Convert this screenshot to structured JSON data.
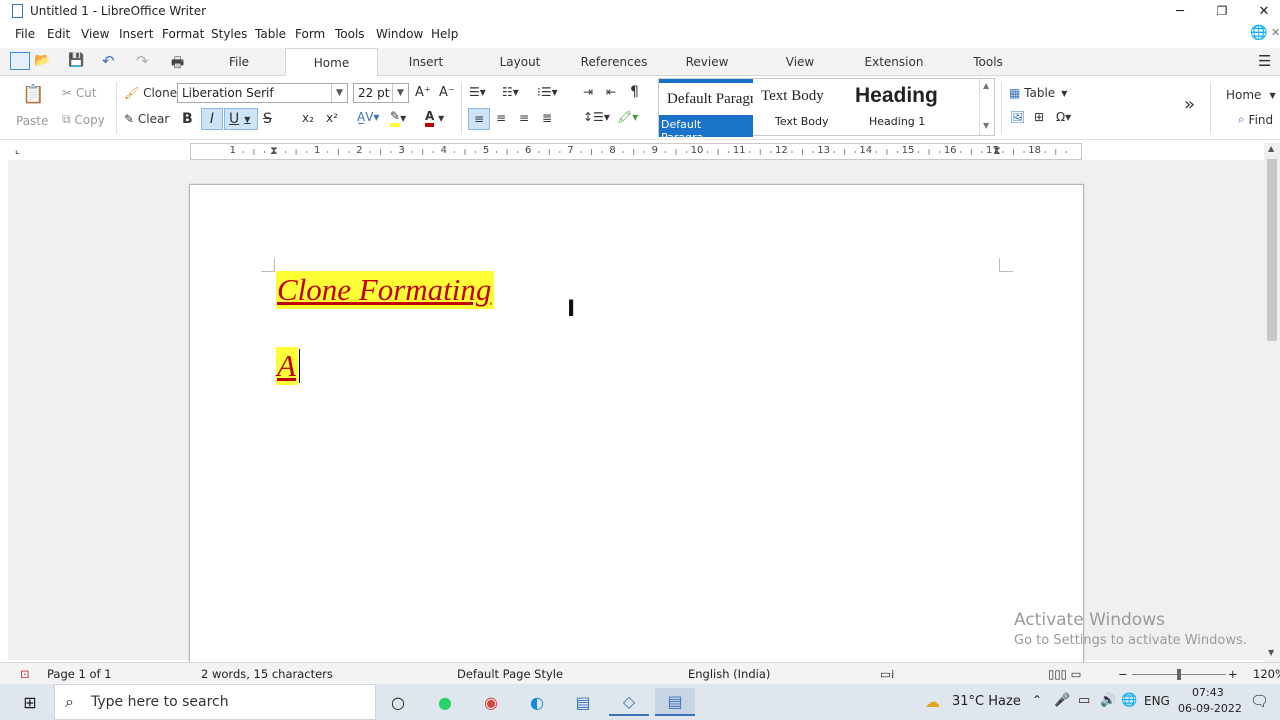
{
  "window": {
    "title": "Untitled 1 - LibreOffice Writer",
    "minimize": "─",
    "restore": "❐",
    "close": "✕"
  },
  "menu": [
    "File",
    "Edit",
    "View",
    "Insert",
    "Format",
    "Styles",
    "Table",
    "Form",
    "Tools",
    "Window",
    "Help"
  ],
  "tabs": [
    "File",
    "Home",
    "Insert",
    "Layout",
    "References",
    "Review",
    "View",
    "Extension",
    "Tools"
  ],
  "active_tab": "Home",
  "ribbon": {
    "paste": "Paste",
    "cut": "Cut",
    "copy": "Copy",
    "clone": "Clone",
    "clear": "Clear",
    "font_name": "Liberation Serif",
    "font_size": "22 pt",
    "bold": "B",
    "italic": "I",
    "underline": "U",
    "strike": "S",
    "subscript": "x₂",
    "superscript": "x²",
    "table": "Table",
    "home_dropdown": "Home",
    "find": "Find",
    "more": "»"
  },
  "styles": [
    {
      "preview": "Default Paragr",
      "name": "Default Paragra..."
    },
    {
      "preview": "Text Body",
      "name": "Text Body"
    },
    {
      "preview": "Heading",
      "name": "Heading 1"
    }
  ],
  "ruler_numbers": [
    "1",
    "1",
    "2",
    "3",
    "4",
    "5",
    "6",
    "7",
    "8",
    "9",
    "10",
    "11",
    "12",
    "13",
    "14",
    "15",
    "16",
    "17",
    "18"
  ],
  "document": {
    "line1": "Clone Formating",
    "line2": "A"
  },
  "watermark": {
    "line1": "Activate Windows",
    "line2": "Go to Settings to activate Windows."
  },
  "status": {
    "page": "Page 1 of 1",
    "words": "2 words, 15 characters",
    "page_style": "Default Page Style",
    "language": "English (India)",
    "zoom": "120%"
  },
  "taskbar": {
    "search_placeholder": "Type here to search",
    "weather": "31°C  Haze",
    "lang": "ENG",
    "time": "07:43",
    "date": "06-09-2022"
  },
  "colors": {
    "highlight": "#ffff38",
    "font_color": "#c00000",
    "accent": "#1a73c8"
  }
}
